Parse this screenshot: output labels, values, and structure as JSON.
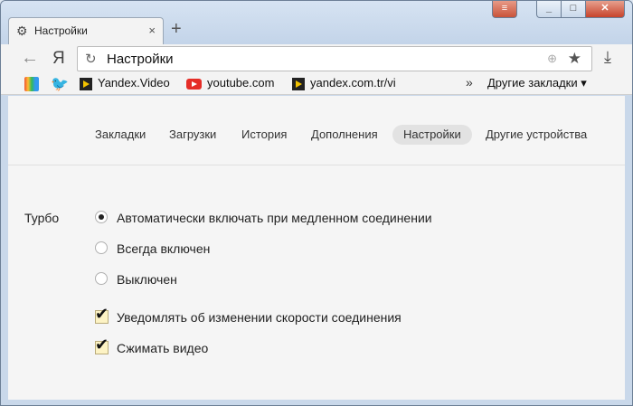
{
  "tab": {
    "title": "Настройки",
    "icon": "gear-icon"
  },
  "toolbar": {
    "yandex_logo": "Я",
    "address": "Настройки"
  },
  "bookmarks": [
    {
      "label": "Yandex.Video",
      "icon": "play-icon"
    },
    {
      "label": "youtube.com",
      "icon": "youtube-icon"
    },
    {
      "label": "yandex.com.tr/vi",
      "icon": "play-icon"
    }
  ],
  "other_bookmarks": "Другие закладки",
  "nav": [
    "Закладки",
    "Загрузки",
    "История",
    "Дополнения",
    "Настройки",
    "Другие устройства"
  ],
  "nav_active": "Настройки",
  "turbo": {
    "label": "Турбо",
    "options": [
      "Автоматически включать при медленном соединении",
      "Всегда включен",
      "Выключен"
    ],
    "selected_index": 0,
    "checks": [
      "Уведомлять об изменении скорости соединения",
      "Сжимать видео"
    ]
  }
}
